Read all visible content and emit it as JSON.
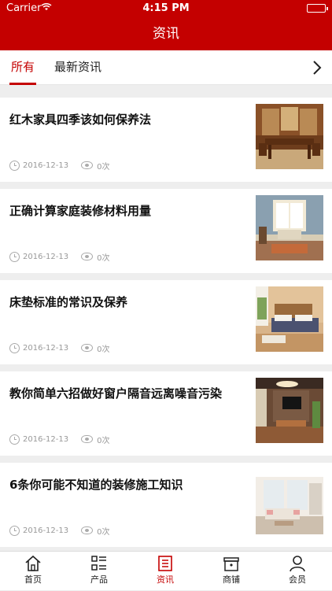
{
  "status": {
    "carrier": "Carrier",
    "time": "4:15 PM"
  },
  "nav": {
    "title": "资讯"
  },
  "tabs": {
    "all": "所有",
    "latest": "最新资讯"
  },
  "articles": [
    {
      "title": "红木家具四季该如何保养法",
      "date": "2016-12-13",
      "views": "0次",
      "image": "dining-room-photo"
    },
    {
      "title": "正确计算家庭装修材料用量",
      "date": "2016-12-13",
      "views": "0次",
      "image": "living-room-photo"
    },
    {
      "title": "床垫标准的常识及保养",
      "date": "2016-12-13",
      "views": "0次",
      "image": "bedroom-photo"
    },
    {
      "title": "教你简单六招做好窗户隔音远离噪音污染",
      "date": "2016-12-13",
      "views": "0次",
      "image": "tv-room-photo"
    },
    {
      "title": "6条你可能不知道的装修施工知识",
      "date": "2016-12-13",
      "views": "0次",
      "image": "white-living-room-photo"
    }
  ],
  "tabbar": {
    "home": "首页",
    "products": "产品",
    "news": "资讯",
    "shops": "商铺",
    "member": "会员"
  },
  "colors": {
    "brand": "#c40000",
    "background": "#eeeeee"
  }
}
